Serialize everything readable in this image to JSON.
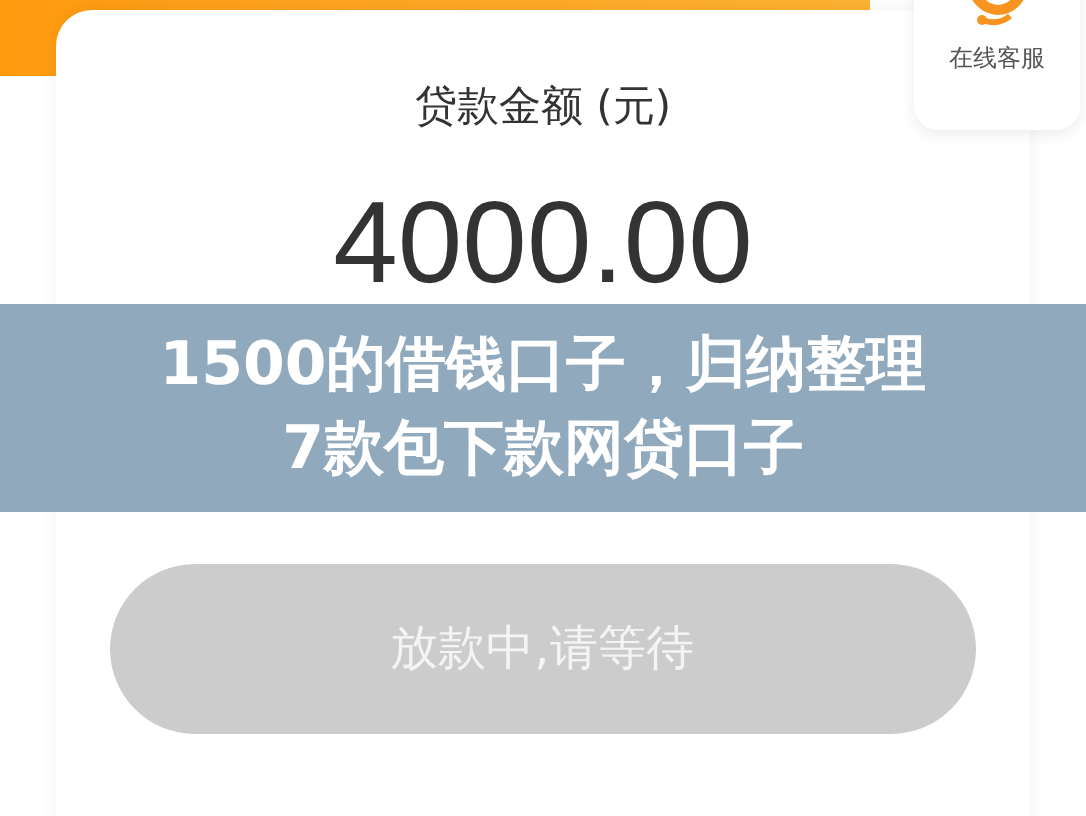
{
  "customer_service": {
    "label": "在线客服"
  },
  "loan": {
    "label": "贷款金额 (元)",
    "amount": "4000.00"
  },
  "status_button": {
    "label": "放款中,请等待",
    "disabled": true
  },
  "overlay_title": {
    "lines": [
      "1500的借钱口子，归纳整理",
      "7款包下款网贷口子"
    ]
  }
}
